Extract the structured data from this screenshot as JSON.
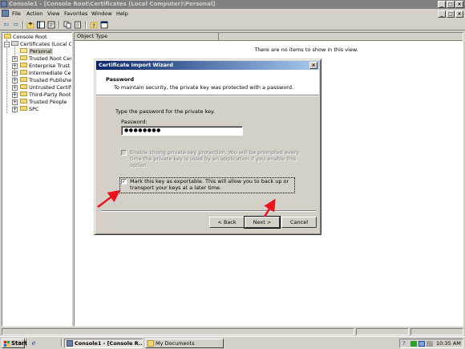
{
  "window": {
    "title": "Console1 - [Console Root\\Certificates (Local Computer)\\Personal]"
  },
  "menu": {
    "items": [
      "File",
      "Action",
      "View",
      "Favorites",
      "Window",
      "Help"
    ]
  },
  "tree": {
    "root": "Console Root",
    "store": "Certificates (Local Com",
    "items": [
      "Personal",
      "Trusted Root Certil",
      "Enterprise Trust",
      "Intermediate Certif",
      "Trusted Publishers",
      "Untrusted Certifica",
      "Third-Party Root C",
      "Trusted People",
      "SPC"
    ]
  },
  "list": {
    "column_header": "Object Type",
    "empty_message": "There are no items to show in this view."
  },
  "dialog": {
    "title": "Certificate Import Wizard",
    "header_title": "Password",
    "header_subtitle": "To maintain security, the private key was protected with a password.",
    "prompt": "Type the password for the private key.",
    "password_label": "Password:",
    "password_value": "●●●●●●●●",
    "option_strong": "Enable strong private key protection. You will be prompted every time the private key is used by an application if you enable this option.",
    "option_exportable": "Mark this key as exportable. This will allow you to back up or transport your keys at a later time.",
    "option_strong_checked": false,
    "option_exportable_checked": true,
    "back_button": "< Back",
    "next_button": "Next >",
    "cancel_button": "Cancel"
  },
  "taskbar": {
    "start": "Start",
    "tasks": [
      "Console1 - [Console R...",
      "My Documents"
    ],
    "clock": "10:35 AM"
  },
  "annotation_color": "#e8131b"
}
